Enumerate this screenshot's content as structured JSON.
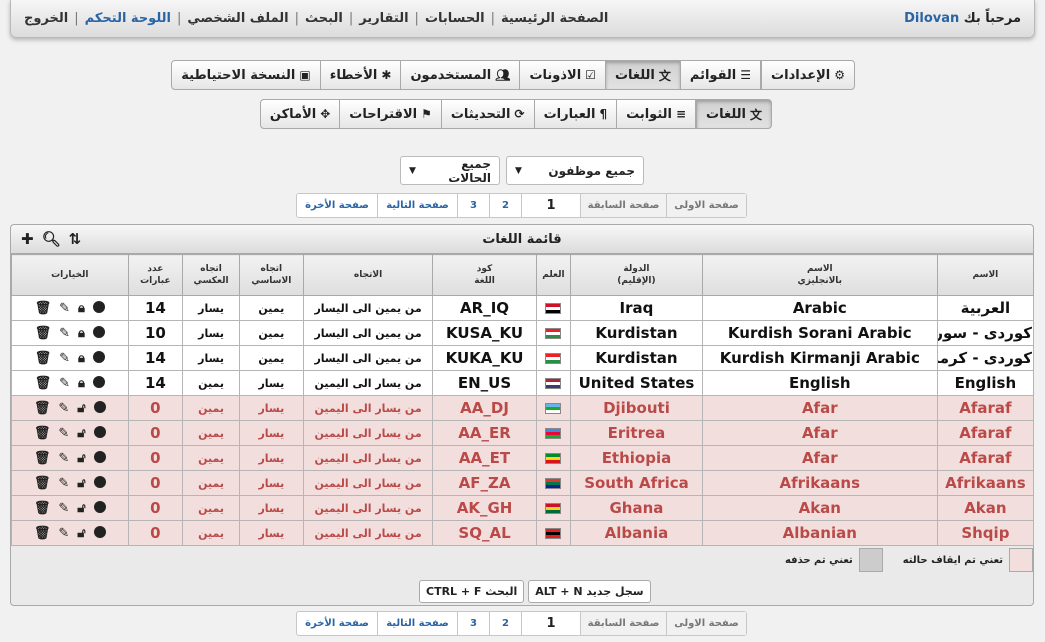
{
  "topbar": {
    "welcome": "مرحباً بك",
    "username": "Dilovan",
    "nav": [
      {
        "label": "الصفحة الرئيسية",
        "active": false
      },
      {
        "label": "الحسابات",
        "active": false
      },
      {
        "label": "التقارير",
        "active": false
      },
      {
        "label": "البحث",
        "active": false
      },
      {
        "label": "الملف الشخصي",
        "active": false
      },
      {
        "label": "اللوحة التحكم",
        "active": true
      },
      {
        "label": "الخروج",
        "active": false
      }
    ]
  },
  "tabs_main": [
    {
      "label": "الإعدادات",
      "icon": "gear-icon",
      "active": false
    },
    {
      "label": "القوائم",
      "icon": "list-icon",
      "active": false
    },
    {
      "label": "اللغات",
      "icon": "language-icon",
      "active": true
    },
    {
      "label": "الاذونات",
      "icon": "checkbox-icon",
      "active": false
    },
    {
      "label": "المستخدمون",
      "icon": "users-icon",
      "active": false
    },
    {
      "label": "الأخطاء",
      "icon": "bug-icon",
      "active": false
    },
    {
      "label": "النسخة الاحتياطية",
      "icon": "briefcase-icon",
      "active": false
    }
  ],
  "tabs_sub": [
    {
      "label": "اللغات",
      "icon": "language-icon",
      "active": true
    },
    {
      "label": "الثوابت",
      "icon": "lines-icon",
      "active": false
    },
    {
      "label": "العبارات",
      "icon": "paragraph-icon",
      "active": false
    },
    {
      "label": "التحديثات",
      "icon": "refresh-icon",
      "active": false
    },
    {
      "label": "الاقتراحات",
      "icon": "flag-icon",
      "active": false
    },
    {
      "label": "الأماكن",
      "icon": "crosshair-icon",
      "active": false
    }
  ],
  "filters": {
    "employees": "جميع موظفون",
    "status": "جميع الحالات"
  },
  "pager": {
    "first": "صفحة الاولى",
    "prev": "صفحة السابقة",
    "current": "1",
    "pages": [
      "2",
      "3"
    ],
    "next": "صفحة التالية",
    "last": "صفحة الأخرة"
  },
  "panel": {
    "title": "قائمة اللغات"
  },
  "columns": [
    "الاسم",
    "الاسم\nبالانجليزي",
    "الدولة\n(الإقليم)",
    "العلم",
    "كود\nاللغة",
    "الاتجاه",
    "اتجاه\nالاساسي",
    "اتجاه\nالعكسي",
    "عدد\nعبارات",
    "الخيارات"
  ],
  "rows": [
    {
      "name": "العربية",
      "english": "Arabic",
      "country": "Iraq",
      "flag": [
        "#ce1126",
        "#ffffff",
        "#000000"
      ],
      "code": "AR_IQ",
      "direction": "من يمين الى اليسار",
      "base": "يمين",
      "reverse": "يسار",
      "count": "14",
      "enabled": true
    },
    {
      "name": "كوردى - سورانى",
      "english": "Kurdish Sorani Arabic",
      "country": "Kurdistan",
      "flag": [
        "#ed2024",
        "#ffffff",
        "#278e43"
      ],
      "code": "KUSA_KU",
      "direction": "من يمين الى اليسار",
      "base": "يمين",
      "reverse": "يسار",
      "count": "10",
      "enabled": true
    },
    {
      "name": "كوردى - كرمانجى",
      "english": "Kurdish Kirmanji Arabic",
      "country": "Kurdistan",
      "flag": [
        "#ed2024",
        "#ffffff",
        "#278e43"
      ],
      "code": "KUKA_KU",
      "direction": "من يمين الى اليسار",
      "base": "يمين",
      "reverse": "يسار",
      "count": "14",
      "enabled": true
    },
    {
      "name": "English",
      "english": "English",
      "country": "United States",
      "flag": [
        "#b22234",
        "#ffffff",
        "#3c3b6e"
      ],
      "code": "EN_US",
      "direction": "من يسار الى اليمين",
      "base": "يسار",
      "reverse": "يمين",
      "count": "14",
      "enabled": true
    },
    {
      "name": "Afaraf",
      "english": "Afar",
      "country": "Djibouti",
      "flag": [
        "#6ab2e7",
        "#12ad2b",
        "#ffffff"
      ],
      "code": "AA_DJ",
      "direction": "من يسار الى اليمين",
      "base": "يسار",
      "reverse": "يمين",
      "count": "0",
      "enabled": false
    },
    {
      "name": "Afaraf",
      "english": "Afar",
      "country": "Eritrea",
      "flag": [
        "#4189dd",
        "#ea0437",
        "#12ad2b"
      ],
      "code": "AA_ER",
      "direction": "من يسار الى اليمين",
      "base": "يسار",
      "reverse": "يمين",
      "count": "0",
      "enabled": false
    },
    {
      "name": "Afaraf",
      "english": "Afar",
      "country": "Ethiopia",
      "flag": [
        "#078930",
        "#fcdd09",
        "#da121a"
      ],
      "code": "AA_ET",
      "direction": "من يسار الى اليمين",
      "base": "يسار",
      "reverse": "يمين",
      "count": "0",
      "enabled": false
    },
    {
      "name": "Afrikaans",
      "english": "Afrikaans",
      "country": "South Africa",
      "flag": [
        "#de3831",
        "#007a4d",
        "#002395"
      ],
      "code": "AF_ZA",
      "direction": "من يسار الى اليمين",
      "base": "يسار",
      "reverse": "يمين",
      "count": "0",
      "enabled": false
    },
    {
      "name": "Akan",
      "english": "Akan",
      "country": "Ghana",
      "flag": [
        "#ce1126",
        "#fcd116",
        "#006b3f"
      ],
      "code": "AK_GH",
      "direction": "من يسار الى اليمين",
      "base": "يسار",
      "reverse": "يمين",
      "count": "0",
      "enabled": false
    },
    {
      "name": "Shqip",
      "english": "Albanian",
      "country": "Albania",
      "flag": [
        "#e41e20",
        "#000000",
        "#e41e20"
      ],
      "code": "SQ_AL",
      "direction": "من يسار الى اليمين",
      "base": "يسار",
      "reverse": "يمين",
      "count": "0",
      "enabled": false
    }
  ],
  "legend": {
    "disabled_label": "تعني تم ايقاف حالته",
    "disabled_color": "#f3dede",
    "deleted_label": "تعني تم حذفه",
    "deleted_color": "#cccccc"
  },
  "shortcuts": [
    {
      "key": "ALT + N",
      "label": "سجل جديد"
    },
    {
      "key": "CTRL + F",
      "label": "البحث"
    }
  ],
  "colors": {
    "accent": "#2a64a5",
    "disabled_row_text": "#b94a48"
  }
}
